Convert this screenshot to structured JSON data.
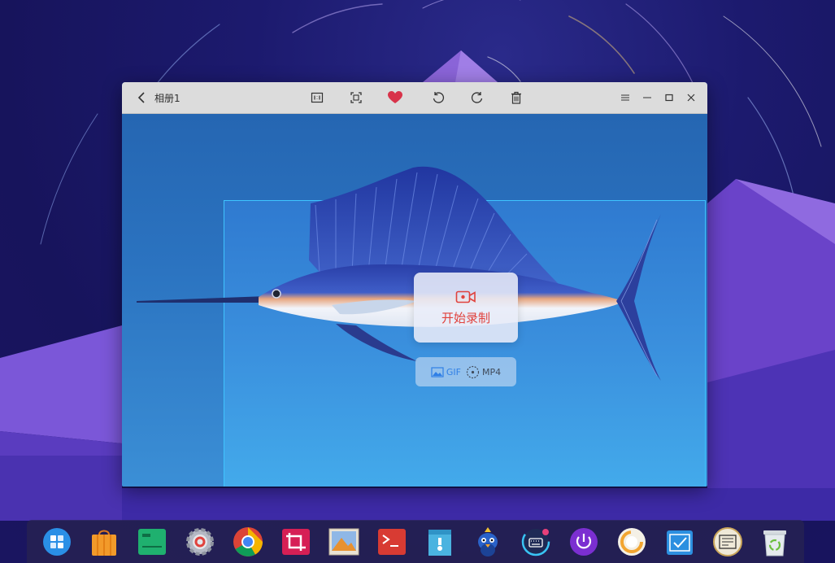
{
  "window": {
    "title": "相册1"
  },
  "toolbar": {
    "buttons": [
      {
        "name": "actual-size-button",
        "icon": "actual-size-icon"
      },
      {
        "name": "fit-window-button",
        "icon": "fit-window-icon"
      },
      {
        "name": "favorite-button",
        "icon": "heart-icon"
      },
      {
        "name": "rotate-left-button",
        "icon": "rotate-left-icon"
      },
      {
        "name": "rotate-right-button",
        "icon": "rotate-right-icon"
      },
      {
        "name": "delete-button",
        "icon": "trash-icon"
      }
    ],
    "window_controls": [
      "menu-icon",
      "minimize-icon",
      "maximize-icon",
      "close-icon"
    ]
  },
  "recorder": {
    "start_label": "开始录制",
    "formats": [
      "GIF",
      "MP4"
    ],
    "accent_color": "#e0423d",
    "selected_color": "#2f7fe6"
  },
  "dock": {
    "items": [
      "launcher-icon",
      "app-store-icon",
      "multitasking-icon",
      "settings-icon",
      "chrome-icon",
      "screenshot-icon",
      "image-viewer-icon",
      "terminal-icon",
      "archive-manager-icon",
      "mascot-icon",
      "input-keyboard-icon",
      "power-icon",
      "system-monitor-icon",
      "task-check-icon",
      "calendar-icon",
      "trash-icon"
    ]
  }
}
